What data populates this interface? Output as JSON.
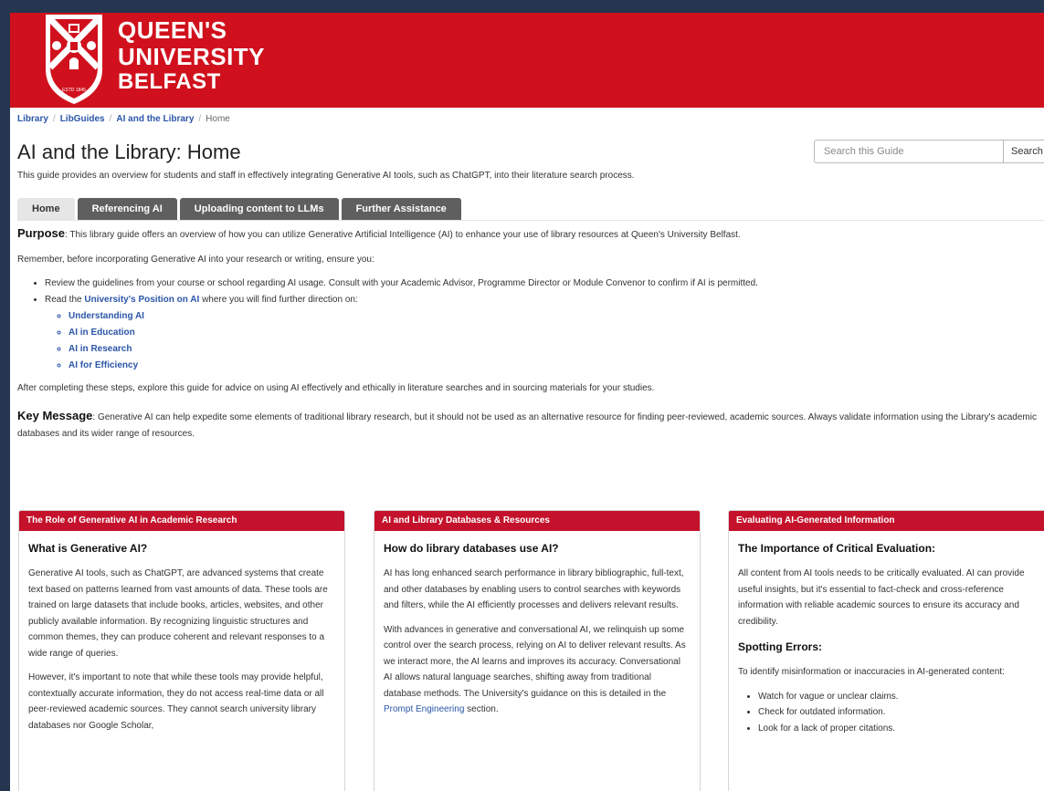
{
  "logo": {
    "line1": "QUEEN'S",
    "line2": "UNIVERSITY",
    "line3": "BELFAST",
    "estd": "ESTD 1845"
  },
  "breadcrumb": {
    "library": "Library",
    "libguides": "LibGuides",
    "guide": "AI and the Library",
    "current": "Home"
  },
  "page": {
    "title": "AI and the Library: Home",
    "subtitle": "This guide provides an overview for students and staff in effectively integrating Generative AI tools, such as ChatGPT, into their literature search process."
  },
  "search": {
    "placeholder": "Search this Guide",
    "button": "Search"
  },
  "tabs": [
    "Home",
    "Referencing AI",
    "Uploading content to LLMs",
    "Further Assistance"
  ],
  "content": {
    "purpose_label": "Purpose",
    "purpose_text": ": This library guide offers an overview of how you can utilize Generative Artificial Intelligence (AI) to enhance your use of library resources at Queen's University Belfast.",
    "remember": "Remember, before incorporating Generative AI into your research or writing, ensure you:",
    "bullet1": "Review the guidelines from your course or school regarding AI usage. Consult with your Academic Advisor, Programme Director or Module Convenor to confirm if AI is permitted.",
    "bullet2_pre": "Read the ",
    "bullet2_link": "University's Position on AI",
    "bullet2_post": " where you will find further direction on:",
    "subitems": [
      "Understanding AI",
      "AI in Education",
      "AI in Research",
      "AI for Efficiency"
    ],
    "after": "After completing these steps, explore this guide for advice on using AI effectively and ethically in literature searches and in sourcing materials for your studies.",
    "key_label": "Key Message",
    "key_text": ": Generative AI can help expedite some elements of traditional library research, but it should not be used as an alternative resource for finding peer-reviewed, academic sources. Always validate information using the Library's academic databases and its wider range of resources."
  },
  "boxes": {
    "b1": {
      "header": "The Role of Generative AI in Academic Research",
      "heading": "What is Generative AI?",
      "p1": "Generative AI tools, such as ChatGPT, are advanced systems that create text based on patterns learned from vast amounts of data. These tools are trained on large datasets that include books, articles, websites, and other publicly available information. By recognizing linguistic structures and common themes, they can produce coherent and relevant responses to a wide range of queries.",
      "p2": "However, it's important to note that while these tools may provide helpful, contextually accurate information, they do not access real-time data or all peer-reviewed academic sources. They cannot search university library databases nor Google Scholar,"
    },
    "b2": {
      "header": "AI and Library Databases & Resources",
      "heading": "How do library databases use AI?",
      "p1": "AI has long enhanced search performance in library bibliographic, full-text, and other databases by enabling users to control searches with keywords and filters, while the AI efficiently processes and delivers relevant results.",
      "p2": "With advances in generative and conversational AI, we relinquish up some control over the search process, relying on AI to deliver relevant results. As we interact more, the AI learns and improves its accuracy. Conversational AI allows natural language searches, shifting away from traditional database methods. The University's guidance on this is detailed in the ",
      "p2_link": "Prompt Engineering",
      "p2_post": " section."
    },
    "b3": {
      "header": "Evaluating AI-Generated Information",
      "heading": "The Importance of Critical Evaluation:",
      "p1": "All content from AI tools needs to be critically evaluated. AI can provide useful insights, but it's essential to fact-check and cross-reference information with reliable academic sources to ensure its accuracy and credibility.",
      "heading2": "Spotting Errors:",
      "p2": "To identify misinformation or inaccuracies in AI-generated content:",
      "items": [
        "Watch for vague or unclear claims.",
        "Check for outdated information.",
        "Look for a lack of proper citations."
      ]
    }
  },
  "colors": {
    "banner": "#d0111d",
    "box_header": "#c4122c",
    "link": "#2b56a8",
    "tab": "#5f5f5f",
    "frame": "#243650"
  }
}
